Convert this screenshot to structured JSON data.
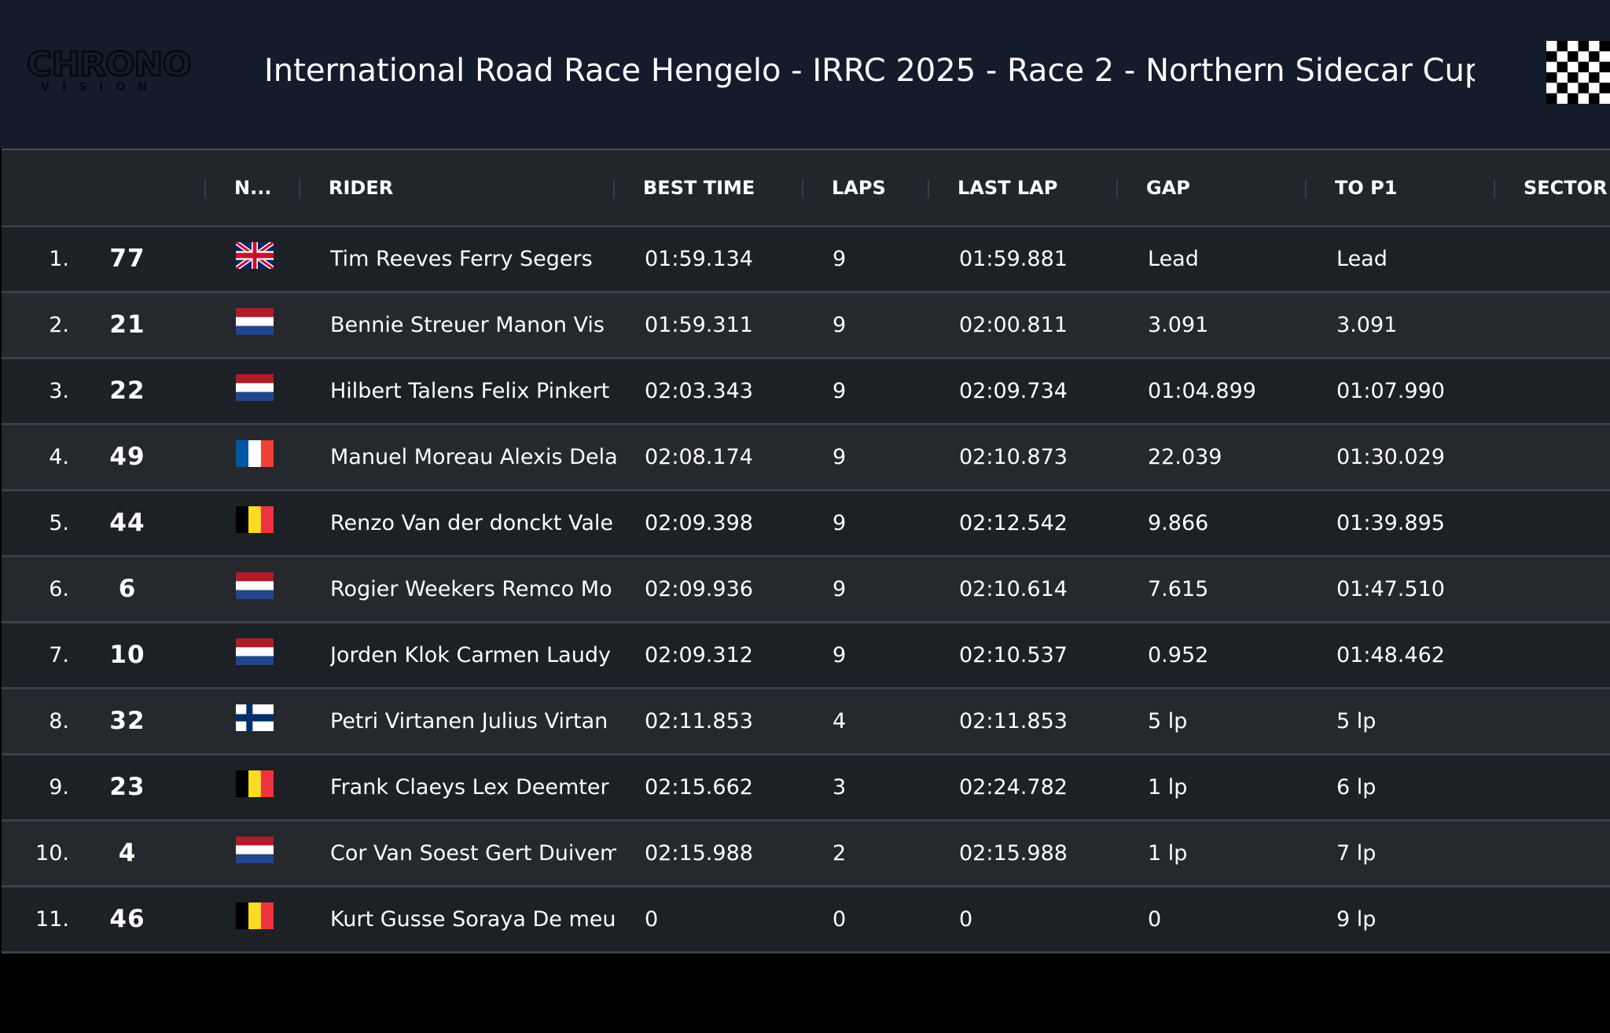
{
  "header": {
    "logo_main": "CHRONO",
    "logo_sub": "VISION",
    "title": "International Road Race Hengelo - IRRC 2025 - Race 2 - Northern Sidecar Cup ..."
  },
  "table": {
    "columns": [
      "N...",
      "RIDER",
      "BEST TIME",
      "LAPS",
      "LAST LAP",
      "GAP",
      "TO P1",
      "SECTOR"
    ],
    "rows": [
      {
        "pos": "1.",
        "num": "77",
        "flag": "uk",
        "rider": "Tim Reeves Ferry Segers",
        "best": "01:59.134",
        "laps": "9",
        "last": "01:59.881",
        "gap": "Lead",
        "top1": "Lead"
      },
      {
        "pos": "2.",
        "num": "21",
        "flag": "nl",
        "rider": "Bennie Streuer Manon Vis",
        "best": "01:59.311",
        "laps": "9",
        "last": "02:00.811",
        "gap": "3.091",
        "top1": "3.091"
      },
      {
        "pos": "3.",
        "num": "22",
        "flag": "nl",
        "rider": "Hilbert Talens Felix Pinkert",
        "best": "02:03.343",
        "laps": "9",
        "last": "02:09.734",
        "gap": "01:04.899",
        "top1": "01:07.990"
      },
      {
        "pos": "4.",
        "num": "49",
        "flag": "fr",
        "rider": "Manuel Moreau Alexis Dela",
        "best": "02:08.174",
        "laps": "9",
        "last": "02:10.873",
        "gap": "22.039",
        "top1": "01:30.029"
      },
      {
        "pos": "5.",
        "num": "44",
        "flag": "be",
        "rider": "Renzo Van der donckt Vale",
        "best": "02:09.398",
        "laps": "9",
        "last": "02:12.542",
        "gap": "9.866",
        "top1": "01:39.895"
      },
      {
        "pos": "6.",
        "num": "6",
        "flag": "nl",
        "rider": "Rogier Weekers Remco Mo",
        "best": "02:09.936",
        "laps": "9",
        "last": "02:10.614",
        "gap": "7.615",
        "top1": "01:47.510"
      },
      {
        "pos": "7.",
        "num": "10",
        "flag": "nl",
        "rider": "Jorden Klok Carmen Laudy",
        "best": "02:09.312",
        "laps": "9",
        "last": "02:10.537",
        "gap": "0.952",
        "top1": "01:48.462"
      },
      {
        "pos": "8.",
        "num": "32",
        "flag": "fi",
        "rider": "Petri Virtanen Julius Virtan",
        "best": "02:11.853",
        "laps": "4",
        "last": "02:11.853",
        "gap": "5 lp",
        "top1": "5 lp"
      },
      {
        "pos": "9.",
        "num": "23",
        "flag": "be",
        "rider": "Frank Claeys Lex Deemter",
        "best": "02:15.662",
        "laps": "3",
        "last": "02:24.782",
        "gap": "1 lp",
        "top1": "6 lp"
      },
      {
        "pos": "10.",
        "num": "4",
        "flag": "nl",
        "rider": "Cor Van Soest Gert Duivem",
        "best": "02:15.988",
        "laps": "2",
        "last": "02:15.988",
        "gap": "1 lp",
        "top1": "7 lp"
      },
      {
        "pos": "11.",
        "num": "46",
        "flag": "be",
        "rider": "Kurt Gusse Soraya De meul",
        "best": "0",
        "laps": "0",
        "last": "0",
        "gap": "0",
        "top1": "9 lp"
      }
    ]
  },
  "colors": {
    "header_bg": "#141b2a",
    "row_dark": "#1d2024",
    "row_light": "#25282c",
    "thead_bg": "#22262b"
  }
}
